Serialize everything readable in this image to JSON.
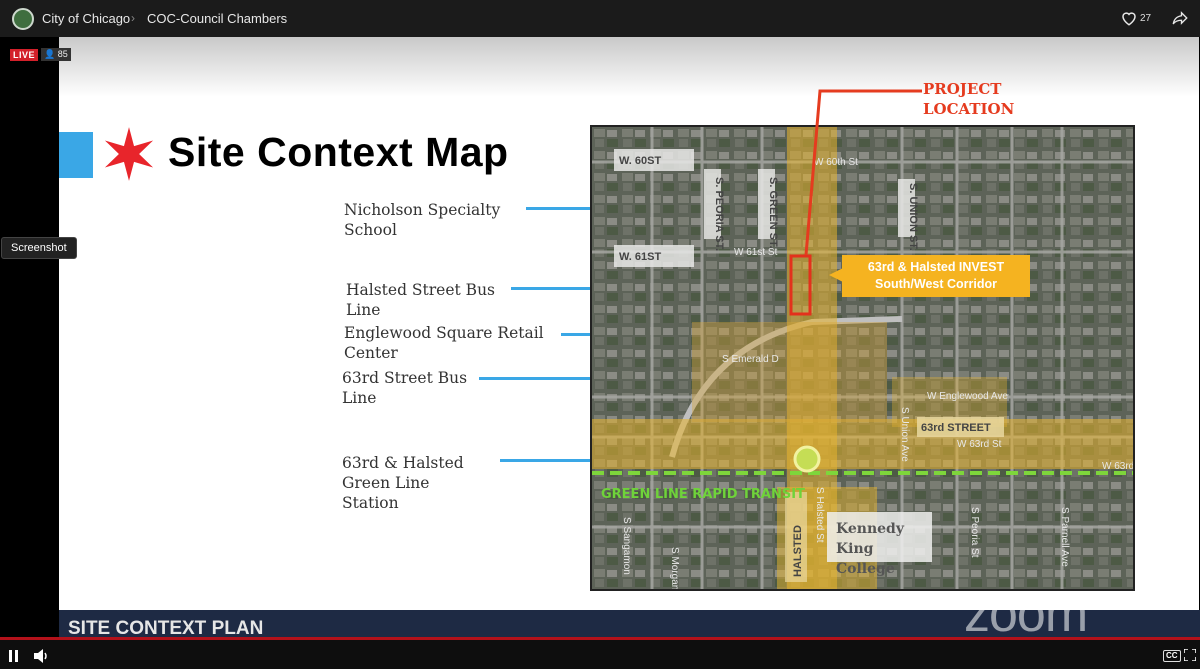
{
  "header": {
    "channel": "City of Chicago",
    "chevron": "›",
    "title": "COC-Council Chambers",
    "likes": "27"
  },
  "live": {
    "badge": "LIVE",
    "viewers": "85"
  },
  "tooltip": "Screenshot",
  "slide": {
    "title": "Site Context Map",
    "labels": {
      "school": [
        "Nicholson Specialty",
        "School"
      ],
      "halsted_bus": [
        "Halsted Street Bus",
        "Line"
      ],
      "englewood": [
        "Englewood Square Retail",
        "Center"
      ],
      "bus63": [
        "63rd Street Bus",
        "Line"
      ],
      "station": [
        "63rd & Halsted",
        "Green Line",
        "Station"
      ]
    },
    "project_location": [
      "PROJECT",
      "LOCATION"
    ],
    "invest_box": [
      "63rd & Halsted INVEST",
      "South/West Corridor"
    ],
    "map_labels": {
      "w60": "W. 60ST",
      "w61": "W. 61ST",
      "peoria": "S. PEORIA ST.",
      "green": "S. GREEN ST.",
      "union": "S. UNION ST.",
      "street63": "63rd STREET",
      "halsted": "HALSTED",
      "green_line": "GREEN LINE RAPID TRANSIT",
      "kennedy": [
        "Kennedy",
        "King",
        "College"
      ],
      "w60th": "W 60th St",
      "w61st": "W 61st St",
      "emerald": "S Emerald D",
      "englewood_ave": "W Englewood Ave",
      "w63rd": "W 63rd St",
      "halsted_st": "S Halsted St",
      "union_ave": "S Union Ave",
      "sparnell": "S Parnell Ave",
      "spauling": "S Peoria St",
      "w63_bottom": "W 63rd",
      "sangamon": "S Sangamon",
      "morgan": "S Morgan"
    }
  },
  "lower_third": "SITE CONTEXT PLAN",
  "watermark": "zoom",
  "controls": {
    "cc": "CC"
  }
}
